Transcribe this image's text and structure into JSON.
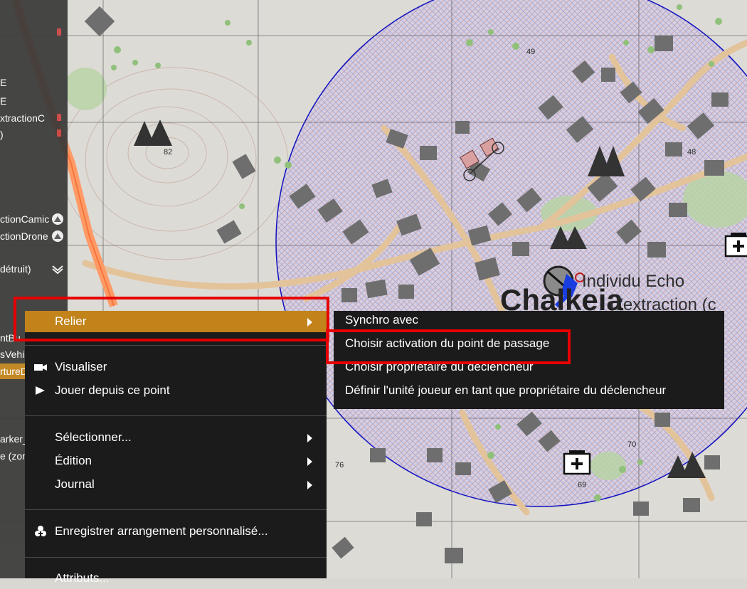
{
  "left_panel": {
    "items": [
      {
        "label": "E"
      },
      {
        "label": "E"
      },
      {
        "label": "xtractionC"
      },
      {
        "label": ")"
      },
      {
        "label": "ctionCamic",
        "icon": "waypoint-icon"
      },
      {
        "label": "ctionDrone",
        "icon": "waypoint-icon"
      },
      {
        "label": "détruit)",
        "icon": "insignia-icon"
      },
      {
        "label": "ntBu"
      },
      {
        "label": "sVehic"
      },
      {
        "label": "rtureD"
      },
      {
        "label": "arker_"
      },
      {
        "label": "e (zon"
      }
    ]
  },
  "map": {
    "labels": {
      "hill_82": "82",
      "grid_49": "49",
      "grid_48": "48",
      "grid_76": "76",
      "grid_70": "70",
      "grid_69": "69",
      "unit_name": "Individu Echo",
      "zone_name": "d'extraction (c",
      "town_name": "Chalkeia"
    },
    "colors": {
      "zone_circle": "#1010c0",
      "road": "#e3c39a",
      "hatch": "#b8aedf"
    }
  },
  "context_menu": {
    "items": [
      {
        "label": "Relier",
        "submenu": true,
        "highlighted": true
      },
      {
        "label": "Visualiser",
        "icon": "camera-icon"
      },
      {
        "label": "Jouer depuis ce point",
        "icon": "play-icon"
      },
      {
        "label": "Sélectionner...",
        "submenu": true
      },
      {
        "label": "Édition",
        "submenu": true
      },
      {
        "label": "Journal",
        "submenu": true
      },
      {
        "label": "Enregistrer arrangement personnalisé...",
        "icon": "save-layout-icon"
      },
      {
        "label": "Attributs..."
      }
    ],
    "accent": "#c2831a"
  },
  "submenu": {
    "items": [
      {
        "label": "Synchro avec"
      },
      {
        "label": "Choisir activation du point de passage"
      },
      {
        "label": "Choisir propriétaire du déclencheur"
      },
      {
        "label": "Définir l'unité joueur en tant que propriétaire du déclencheur"
      }
    ]
  }
}
